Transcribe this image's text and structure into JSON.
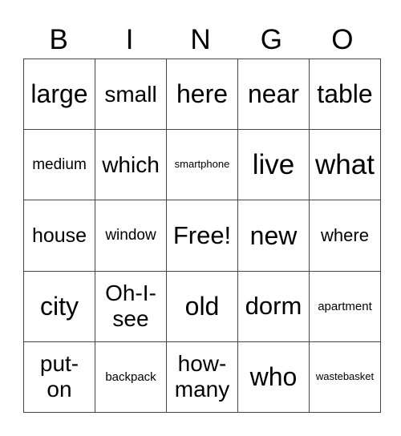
{
  "header": [
    "B",
    "I",
    "N",
    "G",
    "O"
  ],
  "rows": [
    [
      {
        "text": "large",
        "size": "s32"
      },
      {
        "text": "small",
        "size": "s28"
      },
      {
        "text": "here",
        "size": "s32"
      },
      {
        "text": "near",
        "size": "s32"
      },
      {
        "text": "table",
        "size": "s32"
      }
    ],
    [
      {
        "text": "medium",
        "size": "s19"
      },
      {
        "text": "which",
        "size": "s28"
      },
      {
        "text": "smartphone",
        "size": "s13"
      },
      {
        "text": "live",
        "size": "s35"
      },
      {
        "text": "what",
        "size": "s35"
      }
    ],
    [
      {
        "text": "house",
        "size": "s25"
      },
      {
        "text": "window",
        "size": "s19"
      },
      {
        "text": "Free!",
        "size": "s30"
      },
      {
        "text": "new",
        "size": "s32"
      },
      {
        "text": "where",
        "size": "s22"
      }
    ],
    [
      {
        "text": "city",
        "size": "s32"
      },
      {
        "text": "Oh-I-see",
        "size": "s28",
        "lines": [
          "Oh-I-",
          "see"
        ]
      },
      {
        "text": "old",
        "size": "s32"
      },
      {
        "text": "dorm",
        "size": "s30"
      },
      {
        "text": "apartment",
        "size": "s15"
      }
    ],
    [
      {
        "text": "put-on",
        "size": "s28",
        "lines": [
          "put-",
          "on"
        ]
      },
      {
        "text": "backpack",
        "size": "s15"
      },
      {
        "text": "how-many",
        "size": "s28",
        "lines": [
          "how-",
          "many"
        ]
      },
      {
        "text": "who",
        "size": "s32"
      },
      {
        "text": "wastebasket",
        "size": "s13"
      }
    ]
  ]
}
